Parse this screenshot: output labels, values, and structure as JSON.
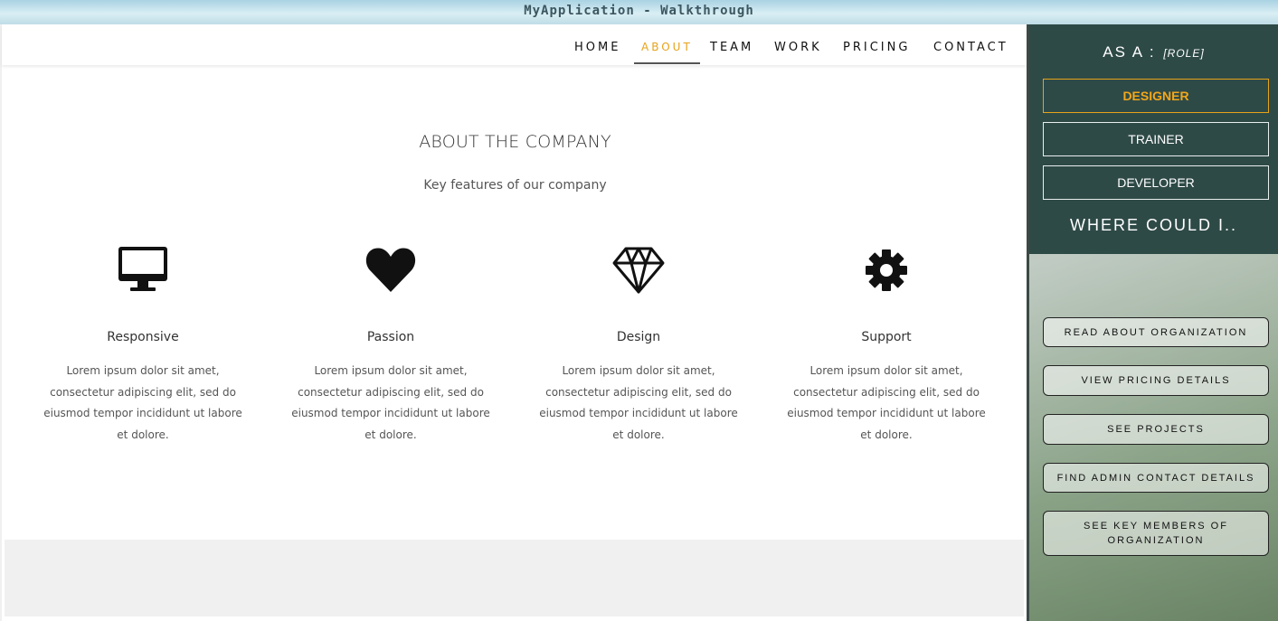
{
  "window": {
    "title": "MyApplication - Walkthrough"
  },
  "nav": {
    "items": [
      {
        "label": "HOME"
      },
      {
        "label": "ABOUT"
      },
      {
        "label": "TEAM"
      },
      {
        "label": "WORK"
      },
      {
        "label": "PRICING"
      },
      {
        "label": "CONTACT"
      }
    ],
    "active": "ABOUT",
    "active_color": "#e6a31a"
  },
  "about": {
    "title": "ABOUT THE COMPANY",
    "subtitle": "Key features of our company",
    "features": [
      {
        "icon": "desktop-icon",
        "title": "Responsive",
        "desc": "Lorem ipsum dolor sit amet, consectetur adipiscing elit, sed do eiusmod tempor incididunt ut labore et dolore."
      },
      {
        "icon": "heart-icon",
        "title": "Passion",
        "desc": "Lorem ipsum dolor sit amet, consectetur adipiscing elit, sed do eiusmod tempor incididunt ut labore et dolore."
      },
      {
        "icon": "diamond-icon",
        "title": "Design",
        "desc": "Lorem ipsum dolor sit amet, consectetur adipiscing elit, sed do eiusmod tempor incididunt ut labore et dolore."
      },
      {
        "icon": "gear-icon",
        "title": "Support",
        "desc": "Lorem ipsum dolor sit amet, consectetur adipiscing elit, sed do eiusmod tempor incididunt ut labore et dolore."
      }
    ]
  },
  "sidebar": {
    "role_heading": "AS A :",
    "role_hint": "[ROLE]",
    "roles": [
      {
        "label": "DESIGNER"
      },
      {
        "label": "TRAINER"
      },
      {
        "label": "DEVELOPER"
      }
    ],
    "selected_role": "DESIGNER",
    "panel_color": "#2e4a47",
    "where_heading": "WHERE COULD I..",
    "actions": [
      {
        "label": "READ ABOUT ORGANIZATION"
      },
      {
        "label": "VIEW PRICING DETAILS"
      },
      {
        "label": "SEE PROJECTS"
      },
      {
        "label": "FIND ADMIN CONTACT DETAILS"
      },
      {
        "label": "SEE KEY MEMBERS OF ORGANIZATION"
      }
    ]
  }
}
